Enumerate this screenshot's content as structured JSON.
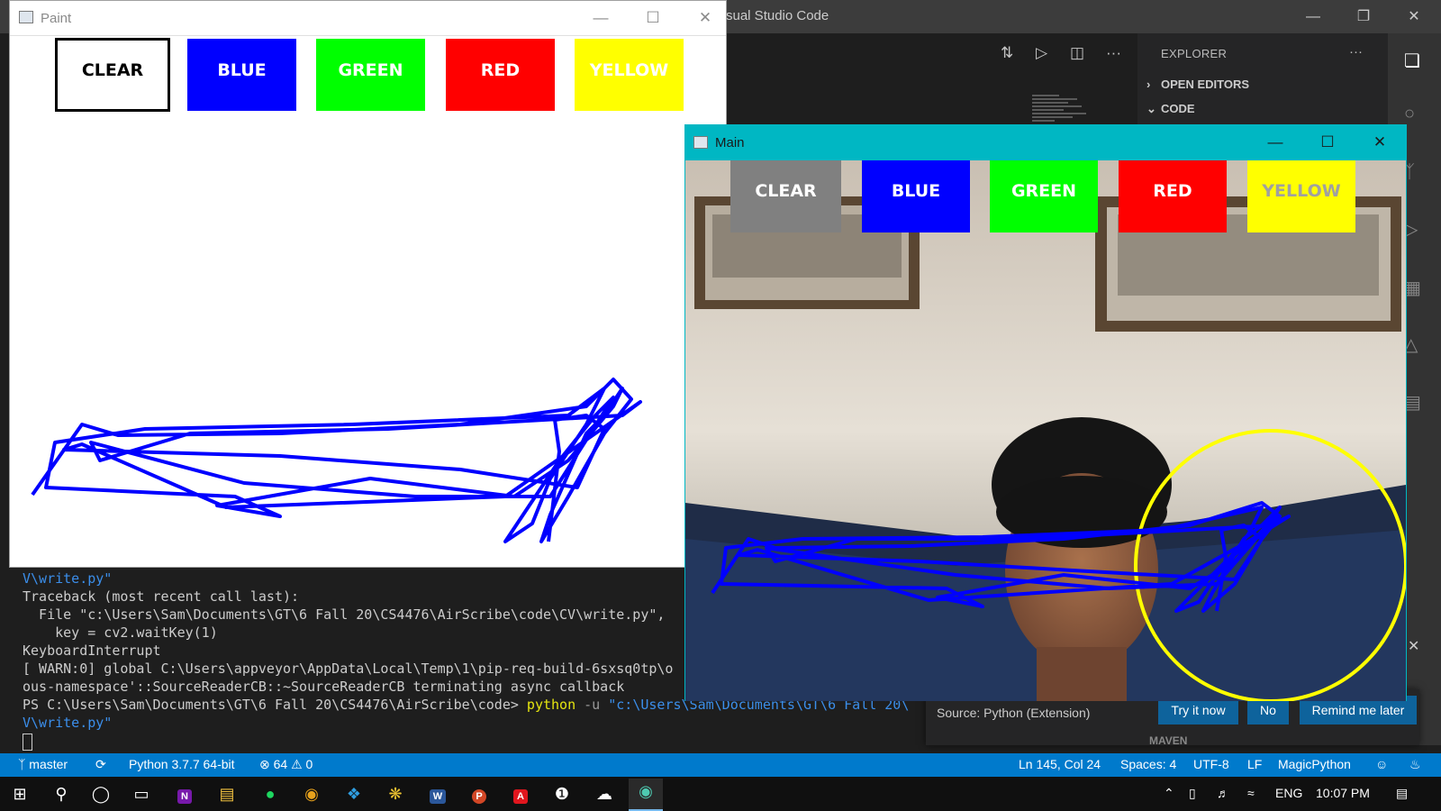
{
  "vscode": {
    "title": "sual Studio Code",
    "explorer_header": "EXPLORER",
    "sections": [
      "OPEN EDITORS",
      "CODE"
    ],
    "bottom_section": "MAVEN"
  },
  "terminal": {
    "lines": [
      "V\\write.py\"",
      "Traceback (most recent call last):",
      "  File \"c:\\Users\\Sam\\Documents\\GT\\6 Fall 20\\CS4476\\AirScribe\\code\\CV\\write.py\",",
      "    key = cv2.waitKey(1)",
      "KeyboardInterrupt",
      "[ WARN:0] global C:\\Users\\appveyor\\AppData\\Local\\Temp\\1\\pip-req-build-6sxsq0tp\\o",
      "ous-namespace'::SourceReaderCB::~SourceReaderCB terminating async callback"
    ],
    "prompt": "PS C:\\Users\\Sam\\Documents\\GT\\6 Fall 20\\CS4476\\AirScribe\\code> ",
    "command": "python",
    "flag": " -u ",
    "arg": "\"c:\\Users\\Sam\\Documents\\GT\\6 Fall 20\\",
    "last_line": "V\\write.py\""
  },
  "notification": {
    "source": "Source: Python (Extension)",
    "try_label": "Try it now",
    "no_label": "No",
    "remind_label": "Remind me later"
  },
  "statusbar": {
    "branch": "master",
    "python": "Python 3.7.7 64-bit",
    "errors": "64",
    "warnings": "0",
    "position": "Ln 145, Col 24",
    "spaces": "Spaces: 4",
    "encoding": "UTF-8",
    "eol": "LF",
    "language": "MagicPython"
  },
  "taskbar": {
    "lang": "ENG",
    "time": "10:07 PM"
  },
  "paint": {
    "title": "Paint",
    "buttons": [
      {
        "label": "CLEAR",
        "bg": "#ffffff",
        "fg": "#000000"
      },
      {
        "label": "BLUE",
        "bg": "#0000ff",
        "fg": "#ffffff"
      },
      {
        "label": "GREEN",
        "bg": "#00ff00",
        "fg": "#ffffff"
      },
      {
        "label": "RED",
        "bg": "#ff0000",
        "fg": "#ffffff"
      },
      {
        "label": "YELLOW",
        "bg": "#ffff00",
        "fg": "#ffffff"
      }
    ]
  },
  "main": {
    "title": "Main",
    "buttons": [
      {
        "label": "CLEAR",
        "bg": "#808080",
        "fg": "#ffffff"
      },
      {
        "label": "BLUE",
        "bg": "#0000ff",
        "fg": "#ffffff"
      },
      {
        "label": "GREEN",
        "bg": "#00ff00",
        "fg": "#ffffff"
      },
      {
        "label": "RED",
        "bg": "#ff0000",
        "fg": "#ffffff"
      },
      {
        "label": "YELLOW",
        "bg": "#ffff00",
        "fg": "#a0a0a0"
      }
    ]
  },
  "colors": {
    "stroke": "#0000ff",
    "pointer_circle": "#ffff00",
    "statusbar": "#007acc",
    "main_titlebar": "#00b7c3"
  }
}
